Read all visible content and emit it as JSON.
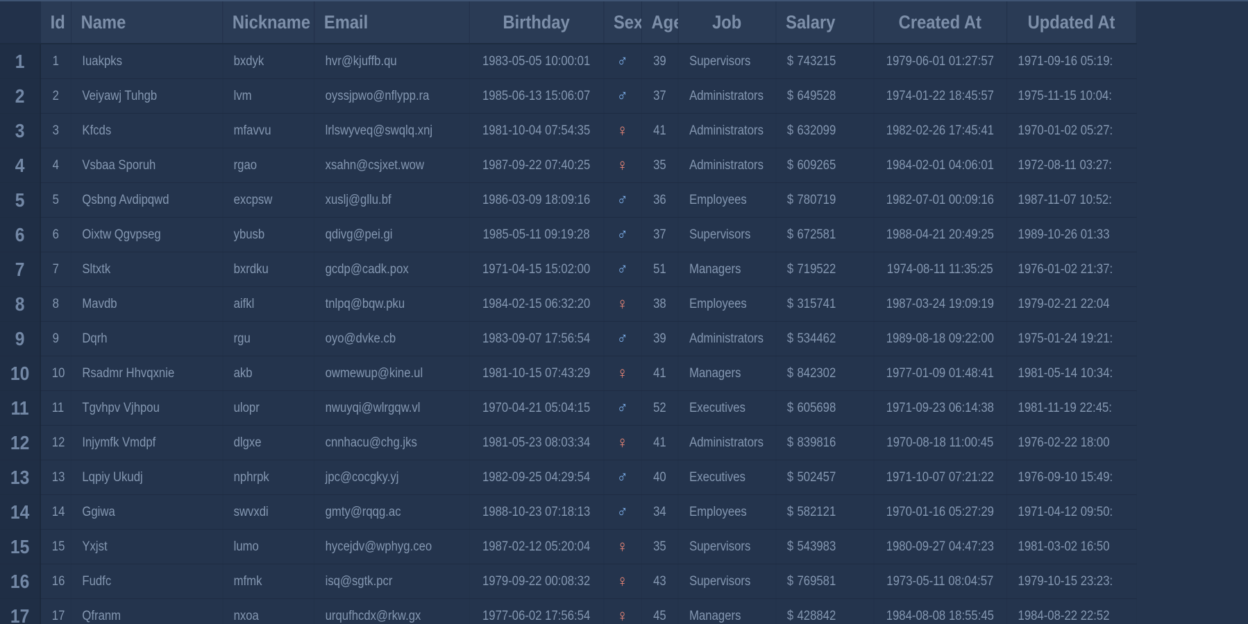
{
  "columns": [
    "Id",
    "Name",
    "Nickname",
    "Email",
    "Birthday",
    "Sex",
    "Age",
    "Job",
    "Salary",
    "Created At",
    "Updated At"
  ],
  "currency_symbol": "$",
  "colors": {
    "background": "#24344d",
    "male": "#7fb2ee",
    "female": "#f28a78"
  },
  "rows": [
    {
      "rn": "1",
      "id": "1",
      "name": "Iuakpks",
      "nickname": "bxdyk",
      "email": "hvr@kjuffb.qu",
      "birthday": "1983-05-05 10:00:01",
      "sex": "male",
      "sex_icon": "♂",
      "age": "39",
      "job": "Supervisors",
      "salary": "743215",
      "created_at": "1979-06-01 01:27:57",
      "updated_at": "1971-09-16 05:19:"
    },
    {
      "rn": "2",
      "id": "2",
      "name": "Veiyawj Tuhgb",
      "nickname": "lvm",
      "email": "oyssjpwo@nflypp.ra",
      "birthday": "1985-06-13 15:06:07",
      "sex": "male",
      "sex_icon": "♂",
      "age": "37",
      "job": "Administrators",
      "salary": "649528",
      "created_at": "1974-01-22 18:45:57",
      "updated_at": "1975-11-15 10:04:"
    },
    {
      "rn": "3",
      "id": "3",
      "name": "Kfcds",
      "nickname": "mfavvu",
      "email": "lrlswyveq@swqlq.xnj",
      "birthday": "1981-10-04 07:54:35",
      "sex": "female",
      "sex_icon": "♀",
      "age": "41",
      "job": "Administrators",
      "salary": "632099",
      "created_at": "1982-02-26 17:45:41",
      "updated_at": "1970-01-02 05:27:"
    },
    {
      "rn": "4",
      "id": "4",
      "name": "Vsbaa Sporuh",
      "nickname": "rgao",
      "email": "xsahn@csjxet.wow",
      "birthday": "1987-09-22 07:40:25",
      "sex": "female",
      "sex_icon": "♀",
      "age": "35",
      "job": "Administrators",
      "salary": "609265",
      "created_at": "1984-02-01 04:06:01",
      "updated_at": "1972-08-11 03:27:"
    },
    {
      "rn": "5",
      "id": "5",
      "name": "Qsbng Avdipqwd",
      "nickname": "excpsw",
      "email": "xuslj@gllu.bf",
      "birthday": "1986-03-09 18:09:16",
      "sex": "male",
      "sex_icon": "♂",
      "age": "36",
      "job": "Employees",
      "salary": "780719",
      "created_at": "1982-07-01 00:09:16",
      "updated_at": "1987-11-07 10:52:"
    },
    {
      "rn": "6",
      "id": "6",
      "name": "Oixtw Qgvpseg",
      "nickname": "ybusb",
      "email": "qdivg@pei.gi",
      "birthday": "1985-05-11 09:19:28",
      "sex": "male",
      "sex_icon": "♂",
      "age": "37",
      "job": "Supervisors",
      "salary": "672581",
      "created_at": "1988-04-21 20:49:25",
      "updated_at": "1989-10-26 01:33"
    },
    {
      "rn": "7",
      "id": "7",
      "name": "Sltxtk",
      "nickname": "bxrdku",
      "email": "gcdp@cadk.pox",
      "birthday": "1971-04-15 15:02:00",
      "sex": "male",
      "sex_icon": "♂",
      "age": "51",
      "job": "Managers",
      "salary": "719522",
      "created_at": "1974-08-11 11:35:25",
      "updated_at": "1976-01-02 21:37:"
    },
    {
      "rn": "8",
      "id": "8",
      "name": "Mavdb",
      "nickname": "aifkl",
      "email": "tnlpq@bqw.pku",
      "birthday": "1984-02-15 06:32:20",
      "sex": "female",
      "sex_icon": "♀",
      "age": "38",
      "job": "Employees",
      "salary": "315741",
      "created_at": "1987-03-24 19:09:19",
      "updated_at": "1979-02-21 22:04"
    },
    {
      "rn": "9",
      "id": "9",
      "name": "Dqrh",
      "nickname": "rgu",
      "email": "oyo@dvke.cb",
      "birthday": "1983-09-07 17:56:54",
      "sex": "male",
      "sex_icon": "♂",
      "age": "39",
      "job": "Administrators",
      "salary": "534462",
      "created_at": "1989-08-18 09:22:00",
      "updated_at": "1975-01-24 19:21:"
    },
    {
      "rn": "10",
      "id": "10",
      "name": "Rsadmr Hhvqxnie",
      "nickname": "akb",
      "email": "owmewup@kine.ul",
      "birthday": "1981-10-15 07:43:29",
      "sex": "female",
      "sex_icon": "♀",
      "age": "41",
      "job": "Managers",
      "salary": "842302",
      "created_at": "1977-01-09 01:48:41",
      "updated_at": "1981-05-14 10:34:"
    },
    {
      "rn": "11",
      "id": "11",
      "name": "Tgvhpv Vjhpou",
      "nickname": "ulopr",
      "email": "nwuyqi@wlrgqw.vl",
      "birthday": "1970-04-21 05:04:15",
      "sex": "male",
      "sex_icon": "♂",
      "age": "52",
      "job": "Executives",
      "salary": "605698",
      "created_at": "1971-09-23 06:14:38",
      "updated_at": "1981-11-19 22:45:"
    },
    {
      "rn": "12",
      "id": "12",
      "name": "Injymfk Vmdpf",
      "nickname": "dlgxe",
      "email": "cnnhacu@chg.jks",
      "birthday": "1981-05-23 08:03:34",
      "sex": "female",
      "sex_icon": "♀",
      "age": "41",
      "job": "Administrators",
      "salary": "839816",
      "created_at": "1970-08-18 11:00:45",
      "updated_at": "1976-02-22 18:00"
    },
    {
      "rn": "13",
      "id": "13",
      "name": "Lqpiy Ukudj",
      "nickname": "nphrpk",
      "email": "jpc@cocgky.yj",
      "birthday": "1982-09-25 04:29:54",
      "sex": "male",
      "sex_icon": "♂",
      "age": "40",
      "job": "Executives",
      "salary": "502457",
      "created_at": "1971-10-07 07:21:22",
      "updated_at": "1976-09-10 15:49:"
    },
    {
      "rn": "14",
      "id": "14",
      "name": "Ggiwa",
      "nickname": "swvxdi",
      "email": "gmty@rqqg.ac",
      "birthday": "1988-10-23 07:18:13",
      "sex": "male",
      "sex_icon": "♂",
      "age": "34",
      "job": "Employees",
      "salary": "582121",
      "created_at": "1970-01-16 05:27:29",
      "updated_at": "1971-04-12 09:50:"
    },
    {
      "rn": "15",
      "id": "15",
      "name": "Yxjst",
      "nickname": "lumo",
      "email": "hycejdv@wphyg.ceo",
      "birthday": "1987-02-12 05:20:04",
      "sex": "female",
      "sex_icon": "♀",
      "age": "35",
      "job": "Supervisors",
      "salary": "543983",
      "created_at": "1980-09-27 04:47:23",
      "updated_at": "1981-03-02 16:50"
    },
    {
      "rn": "16",
      "id": "16",
      "name": "Fudfc",
      "nickname": "mfmk",
      "email": "isq@sgtk.pcr",
      "birthday": "1979-09-22 00:08:32",
      "sex": "female",
      "sex_icon": "♀",
      "age": "43",
      "job": "Supervisors",
      "salary": "769581",
      "created_at": "1973-05-11 08:04:57",
      "updated_at": "1979-10-15 23:23:"
    },
    {
      "rn": "17",
      "id": "17",
      "name": "Qfranm",
      "nickname": "nxoa",
      "email": "urqufhcdx@rkw.gx",
      "birthday": "1977-06-02 17:56:54",
      "sex": "female",
      "sex_icon": "♀",
      "age": "45",
      "job": "Managers",
      "salary": "428842",
      "created_at": "1984-08-08 18:55:45",
      "updated_at": "1984-08-22 22:52"
    }
  ]
}
